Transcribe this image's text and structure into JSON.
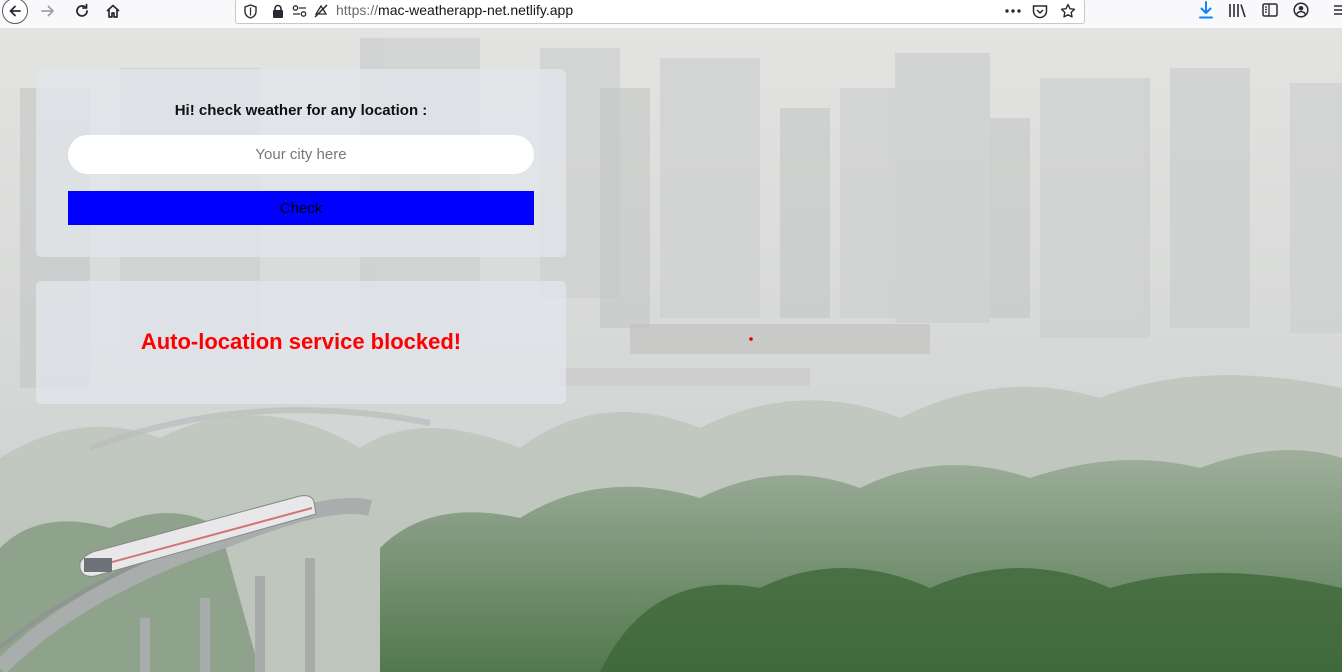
{
  "browser": {
    "url_protocol": "https://",
    "url_host": "mac-weatherapp-net.netlify.app",
    "icons": [
      "back-arrow-icon",
      "forward-arrow-icon",
      "reload-icon",
      "home-icon",
      "shield-icon",
      "lock-icon",
      "permissions-icon",
      "tracking-icon",
      "page-actions-icon",
      "pocket-icon",
      "bookmark-star-icon",
      "download-icon",
      "library-icon",
      "sidebar-icon",
      "account-icon",
      "menu-icon"
    ]
  },
  "search": {
    "prompt": "Hi! check weather for any location :",
    "input_placeholder": "Your city here",
    "input_value": "",
    "button_label": "Check"
  },
  "status": {
    "message": "Auto-location service blocked!"
  },
  "colors": {
    "button_bg": "#0000ff",
    "error_text": "#ff0000",
    "card_bg": "rgba(226,230,235,0.78)"
  }
}
